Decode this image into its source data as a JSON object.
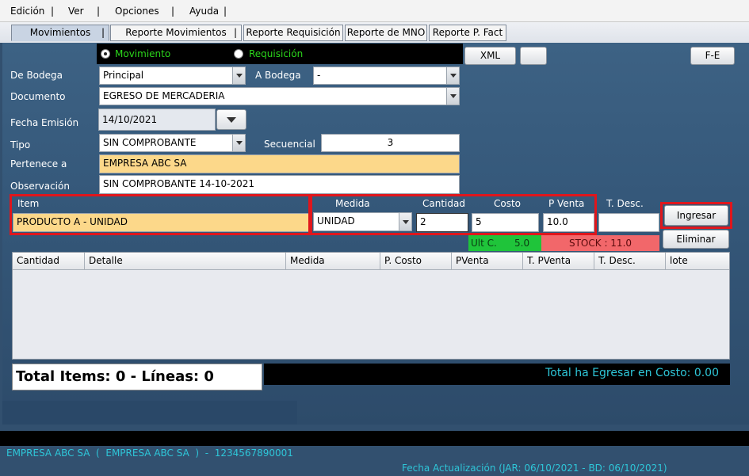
{
  "menu": [
    "Edición",
    "|",
    "Ver",
    "|",
    "Opciones",
    "|",
    "Ayuda",
    "|"
  ],
  "tabs": [
    {
      "label": "Movimientos",
      "active": true
    },
    {
      "label": "Reporte Movimientos",
      "active": false
    },
    {
      "label": "Reporte Requisición",
      "active": false
    },
    {
      "label": "Reporte de MNO",
      "active": false
    },
    {
      "label": "Reporte P. Fact",
      "active": false
    }
  ],
  "tab_separator": "|",
  "mode": {
    "option1": "Movimiento",
    "option2": "Requisición",
    "selected": "Movimiento"
  },
  "buttons": {
    "xml": "XML",
    "blank": "",
    "fe": "F-E",
    "ingresar": "Ingresar",
    "eliminar": "Eliminar"
  },
  "form": {
    "de_bodega_label": "De Bodega",
    "de_bodega_value": "Principal",
    "a_bodega_label": "A Bodega",
    "a_bodega_value": "-",
    "documento_label": "Documento",
    "documento_value": "EGRESO DE MERCADERIA",
    "fecha_label": "Fecha Emisión",
    "fecha_value": "14/10/2021",
    "tipo_label": "Tipo",
    "tipo_value": "SIN COMPROBANTE",
    "secuencial_label": "Secuencial",
    "secuencial_value": "3",
    "pertenece_label": "Pertenece a",
    "pertenece_value": "EMPRESA ABC SA",
    "observacion_label": "Observación",
    "observacion_value": "SIN COMPROBANTE 14-10-2021"
  },
  "item_entry": {
    "item_label": "Item",
    "item_value": "PRODUCTO A - UNIDAD",
    "medida_label": "Medida",
    "medida_value": "UNIDAD",
    "cantidad_label": "Cantidad",
    "cantidad_value": "2",
    "costo_label": "Costo",
    "costo_value": "5",
    "pventa_label": "P Venta",
    "pventa_value": "10.0",
    "tdesc_label": "T. Desc.",
    "tdesc_value": ""
  },
  "indicators": {
    "ult_c_label": "Ult C.",
    "ult_c_value": "5.0",
    "stock_label": "STOCK : 11.0",
    "ult_color": "#1fc43a",
    "stock_color": "#f2676a"
  },
  "table": {
    "columns": [
      "Cantidad",
      "Detalle",
      "Medida",
      "P. Costo",
      "PVenta",
      "T. PVenta",
      "T. Desc.",
      "lote"
    ],
    "rows": []
  },
  "totals": {
    "items_text": "Total Items: 0 - Líneas: 0",
    "cost_text": "Total ha Egresar en Costo: 0.00"
  },
  "status": {
    "left": "EMPRESA ABC SA  (  EMPRESA ABC SA  )  -  1234567890001",
    "right": "Fecha Actualización (JAR: 06/10/2021 - BD: 06/10/2021)"
  },
  "colors": {
    "accent_red": "#e0161c",
    "yellow_field": "#fcd88a",
    "status_text": "#2ec6d8",
    "radio_text": "#2bd61b"
  }
}
